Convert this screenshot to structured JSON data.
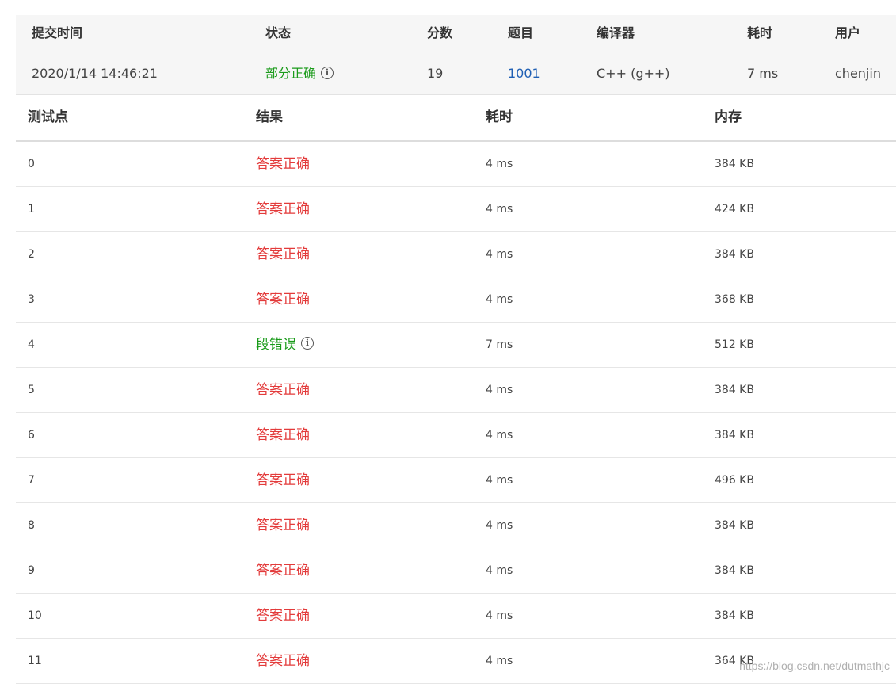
{
  "submission": {
    "headers": {
      "time": "提交时间",
      "status": "状态",
      "score": "分数",
      "problem": "题目",
      "compiler": "编译器",
      "cost": "耗时",
      "user": "用户"
    },
    "row": {
      "time": "2020/1/14 14:46:21",
      "status": "部分正确",
      "score": "19",
      "problem": "1001",
      "compiler": "C++ (g++)",
      "cost": "7 ms",
      "user": "chenjin"
    }
  },
  "cases": {
    "headers": {
      "id": "测试点",
      "result": "结果",
      "cost": "耗时",
      "memory": "内存"
    },
    "rows": [
      {
        "id": "0",
        "result": "答案正确",
        "cost": "4 ms",
        "memory": "384 KB"
      },
      {
        "id": "1",
        "result": "答案正确",
        "cost": "4 ms",
        "memory": "424 KB"
      },
      {
        "id": "2",
        "result": "答案正确",
        "cost": "4 ms",
        "memory": "384 KB"
      },
      {
        "id": "3",
        "result": "答案正确",
        "cost": "4 ms",
        "memory": "368 KB"
      },
      {
        "id": "4",
        "result": "段错误",
        "cost": "7 ms",
        "memory": "512 KB"
      },
      {
        "id": "5",
        "result": "答案正确",
        "cost": "4 ms",
        "memory": "384 KB"
      },
      {
        "id": "6",
        "result": "答案正确",
        "cost": "4 ms",
        "memory": "384 KB"
      },
      {
        "id": "7",
        "result": "答案正确",
        "cost": "4 ms",
        "memory": "496 KB"
      },
      {
        "id": "8",
        "result": "答案正确",
        "cost": "4 ms",
        "memory": "384 KB"
      },
      {
        "id": "9",
        "result": "答案正确",
        "cost": "4 ms",
        "memory": "384 KB"
      },
      {
        "id": "10",
        "result": "答案正确",
        "cost": "4 ms",
        "memory": "384 KB"
      },
      {
        "id": "11",
        "result": "答案正确",
        "cost": "4 ms",
        "memory": "364 KB"
      }
    ]
  },
  "watermark": "https://blog.csdn.net/dutmathjc",
  "colors": {
    "correct": "#e33b3b",
    "partial": "#1a9b1a",
    "link": "#1f5fb4"
  },
  "icons": {
    "info": "info-circle-icon"
  }
}
